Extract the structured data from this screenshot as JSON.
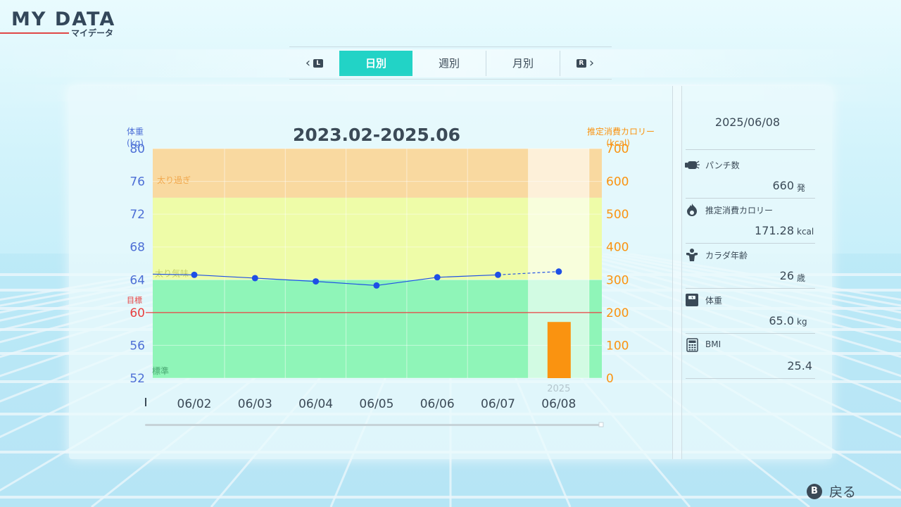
{
  "header": {
    "title": "MY DATA",
    "subtitle": "マイデータ"
  },
  "tabs": {
    "prev_button": "L",
    "next_button": "R",
    "items": [
      {
        "label": "日別",
        "active": true
      },
      {
        "label": "週別",
        "active": false
      },
      {
        "label": "月別",
        "active": false
      }
    ]
  },
  "chart_data": {
    "type": "line",
    "title": "2023.02-2025.06",
    "left_axis": {
      "label_top": "体重",
      "label_unit": "(kg)",
      "ticks": [
        80,
        76,
        72,
        68,
        64,
        60,
        56,
        52
      ],
      "range": [
        52,
        80
      ]
    },
    "right_axis": {
      "label_top": "推定消費カロリー",
      "label_unit": "(kcal)",
      "ticks": [
        700,
        600,
        500,
        400,
        300,
        200,
        100,
        0
      ],
      "range": [
        0,
        700
      ]
    },
    "zones": [
      {
        "label": "太り過ぎ",
        "from": 74,
        "to": 80,
        "color": "#f9d9a0"
      },
      {
        "label": "太り気味",
        "from": 64,
        "to": 74,
        "color": "#eefca8"
      },
      {
        "label": "標準",
        "from": 52,
        "to": 64,
        "color": "#8ff5b8"
      }
    ],
    "goal": {
      "label": "目標",
      "value": 60
    },
    "categories": [
      "06/02",
      "06/03",
      "06/04",
      "06/05",
      "06/06",
      "06/07",
      "06/08"
    ],
    "year_label": "2025",
    "series": [
      {
        "values": [
          64.6,
          64.2,
          63.8,
          63.3,
          64.3,
          64.6,
          65.0
        ],
        "axis": "left",
        "color": "#1e4fe6"
      },
      {
        "values": [
          null,
          null,
          null,
          null,
          null,
          null,
          171.28
        ],
        "axis": "right",
        "type": "bar",
        "color": "#fa9310"
      }
    ],
    "selected_index": 6
  },
  "side": {
    "date": "2025/06/08",
    "stats": [
      {
        "icon": "punch-icon",
        "label": "パンチ数",
        "value": "660",
        "unit": "発"
      },
      {
        "icon": "flame-icon",
        "label": "推定消費カロリー",
        "value": "171.28",
        "unit": "kcal"
      },
      {
        "icon": "body-icon",
        "label": "カラダ年齢",
        "value": "26",
        "unit": "歳"
      },
      {
        "icon": "scale-icon",
        "label": "体重",
        "value": "65.0",
        "unit": "kg"
      },
      {
        "icon": "calculator-icon",
        "label": "BMI",
        "value": "25.4",
        "unit": ""
      }
    ]
  },
  "footer": {
    "back_button": "B",
    "back_label": "戻る"
  },
  "colors": {
    "accent": "#22d3c6",
    "weight": "#1e4fe6",
    "calorie": "#fa9310",
    "goal": "#e84040"
  }
}
